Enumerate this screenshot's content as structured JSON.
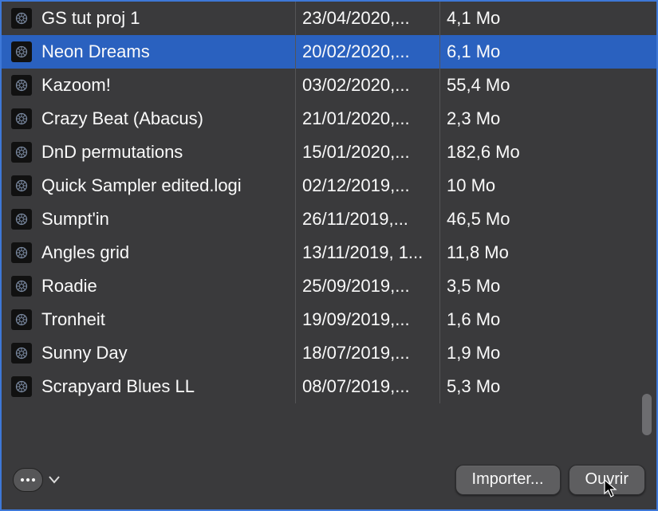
{
  "files": [
    {
      "name": "GS tut proj 1",
      "date": "23/04/2020,...",
      "size": "4,1 Mo",
      "selected": false
    },
    {
      "name": "Neon Dreams",
      "date": "20/02/2020,...",
      "size": "6,1 Mo",
      "selected": true
    },
    {
      "name": "Kazoom!",
      "date": "03/02/2020,...",
      "size": "55,4 Mo",
      "selected": false
    },
    {
      "name": "Crazy Beat (Abacus)",
      "date": "21/01/2020,...",
      "size": "2,3 Mo",
      "selected": false
    },
    {
      "name": "DnD permutations",
      "date": "15/01/2020,...",
      "size": "182,6 Mo",
      "selected": false
    },
    {
      "name": "Quick Sampler edited.logi",
      "date": "02/12/2019,...",
      "size": "10 Mo",
      "selected": false
    },
    {
      "name": "Sumpt'in",
      "date": "26/11/2019,...",
      "size": "46,5 Mo",
      "selected": false
    },
    {
      "name": "Angles grid",
      "date": "13/11/2019, 1...",
      "size": "11,8 Mo",
      "selected": false
    },
    {
      "name": "Roadie",
      "date": "25/09/2019,...",
      "size": "3,5 Mo",
      "selected": false
    },
    {
      "name": "Tronheit",
      "date": "19/09/2019,...",
      "size": "1,6 Mo",
      "selected": false
    },
    {
      "name": "Sunny Day",
      "date": "18/07/2019,...",
      "size": "1,9 Mo",
      "selected": false
    },
    {
      "name": "Scrapyard Blues LL",
      "date": "08/07/2019,...",
      "size": "5,3 Mo",
      "selected": false
    }
  ],
  "footer": {
    "import_label": "Importer...",
    "open_label": "Ouvrir"
  }
}
